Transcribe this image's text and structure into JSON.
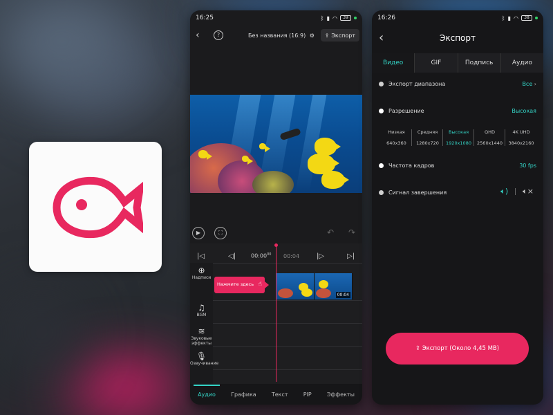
{
  "phone1": {
    "status": {
      "time": "16:25",
      "battery": "39"
    },
    "header": {
      "title": "Без названия (16:9)",
      "export_label": "Экспорт"
    },
    "timeline": {
      "current_time": "00:00",
      "current_sub": "00",
      "end_time": "00:04"
    },
    "side_tools": [
      {
        "label": "Надписи"
      },
      {
        "label": "BGM"
      },
      {
        "label": "Звуковые эффекты"
      },
      {
        "label": "Озвучивание"
      }
    ],
    "clip": {
      "label": "Нажмите здесь",
      "thumb_duration": "00:04"
    },
    "tabs": [
      {
        "label": "Аудио",
        "active": true
      },
      {
        "label": "Графика"
      },
      {
        "label": "Текст"
      },
      {
        "label": "PIP"
      },
      {
        "label": "Эффекты"
      }
    ]
  },
  "phone2": {
    "status": {
      "time": "16:26",
      "battery": "38"
    },
    "header": {
      "title": "Экспорт"
    },
    "tabs": [
      {
        "label": "Видео",
        "active": true
      },
      {
        "label": "GIF"
      },
      {
        "label": "Подпись"
      },
      {
        "label": "Аудио"
      }
    ],
    "settings": {
      "range_label": "Экспорт диапазона",
      "range_value": "Все",
      "resolution_label": "Разрешение",
      "resolution_value": "Высокая",
      "framerate_label": "Частота кадров",
      "framerate_value": "30 fps",
      "end_signal_label": "Сигнал завершения"
    },
    "resolutions": [
      {
        "name": "Низкая",
        "size": "640x360"
      },
      {
        "name": "Средняя",
        "size": "1280x720"
      },
      {
        "name": "Высокая",
        "size": "1920x1080",
        "active": true
      },
      {
        "name": "QHD",
        "size": "2560x1440"
      },
      {
        "name": "4K UHD",
        "size": "3840x2160"
      }
    ],
    "export_button": "Экспорт (Около 4,45 MB)"
  },
  "colors": {
    "accent_pink": "#e8285f",
    "accent_teal": "#34d4c6"
  }
}
